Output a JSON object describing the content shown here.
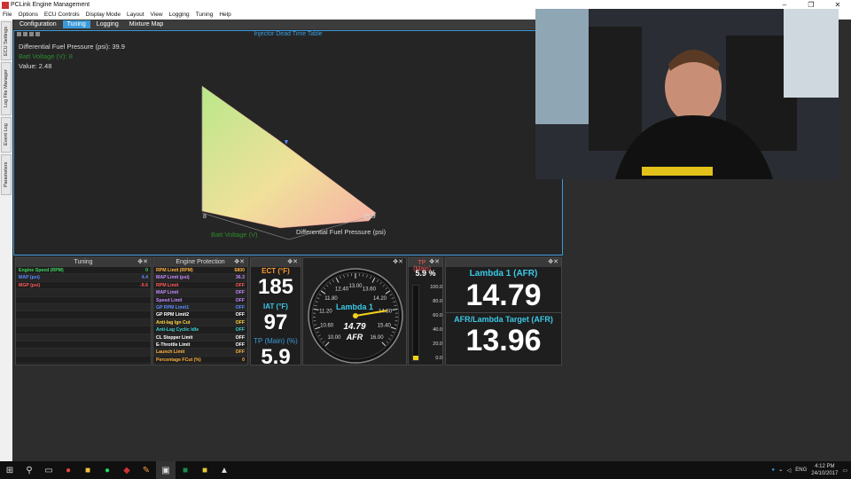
{
  "window": {
    "title": "PCLink Engine Management",
    "controls": [
      "–",
      "❐",
      "✕"
    ]
  },
  "menu": [
    "File",
    "Options",
    "ECU Controls",
    "Display Mode",
    "Layout",
    "View",
    "Logging",
    "Tuning",
    "Help"
  ],
  "side_tabs": [
    "ECU Settings",
    "Log File Manager",
    "Event Log",
    "Parameters"
  ],
  "tabs": [
    {
      "label": "Configuration",
      "active": false
    },
    {
      "label": "Tuning",
      "active": true
    },
    {
      "label": "Logging",
      "active": false
    },
    {
      "label": "Mixture Map",
      "active": false
    }
  ],
  "table3d": {
    "title": "Injector Dead Time Table",
    "info_line1": "Differential Fuel Pressure (psi): 39.9",
    "info_line2": "Batt Voltage (V): 8",
    "info_line3": "Value: 2.48",
    "axis_left_val": "8",
    "axis_right_val": "39.9",
    "axis_label_x": "Differential Fuel Pressure (psi)",
    "axis_label_y": "Batt Voltage (V)",
    "surface_colors": {
      "high": "#b9e88a",
      "low": "#f6b0a6"
    }
  },
  "tuning_panel": {
    "title": "Tuning",
    "rows": [
      {
        "name": "Engine Speed (RPM)",
        "value": "0",
        "color": "#3cd45a"
      },
      {
        "name": "MAP (psi)",
        "value": "4.4",
        "color": "#5a8cff"
      },
      {
        "name": "MGP (psi)",
        "value": "-9.6",
        "color": "#ff5a5a"
      }
    ]
  },
  "engine_protection": {
    "title": "Engine Protection",
    "rows": [
      {
        "name": "RPM Limit (RPM)",
        "value": "6800",
        "color": "#ffb13c",
        "vcolor": "#ffb13c"
      },
      {
        "name": "MAP Limit (psi)",
        "value": "36.3",
        "color": "#c48cff",
        "vcolor": "#c48cff"
      },
      {
        "name": "RPM Limit",
        "value": "OFF",
        "color": "#ff5a5a",
        "vcolor": "#ff5a5a"
      },
      {
        "name": "MAP Limit",
        "value": "OFF",
        "color": "#c48cff",
        "vcolor": "#c48cff"
      },
      {
        "name": "Speed Limit",
        "value": "OFF",
        "color": "#c48cff",
        "vcolor": "#c48cff"
      },
      {
        "name": "GP RPM Limit1",
        "value": "OFF",
        "color": "#5a8cff",
        "vcolor": "#5a8cff"
      },
      {
        "name": "GP RPM Limit2",
        "value": "OFF",
        "color": "#ffffff",
        "vcolor": "#ffffff"
      },
      {
        "name": "Anti-lag Ign Cut",
        "value": "OFF",
        "color": "#ffd23c",
        "vcolor": "#ffd23c"
      },
      {
        "name": "Anti-Lag Cyclic Idle",
        "value": "OFF",
        "color": "#3cd4d4",
        "vcolor": "#3cd4d4"
      },
      {
        "name": "CL Stepper Limit",
        "value": "OFF",
        "color": "#ffffff",
        "vcolor": "#ffffff"
      },
      {
        "name": "E-Throttle Limit",
        "value": "OFF",
        "color": "#ffffff",
        "vcolor": "#ffffff"
      },
      {
        "name": "Launch Limit",
        "value": "OFF",
        "color": "#ffb13c",
        "vcolor": "#ffb13c"
      },
      {
        "name": "Percentage FCut (%)",
        "value": "0",
        "color": "#ffb13c",
        "vcolor": "#ffb13c"
      }
    ]
  },
  "temps": {
    "ect_label": "ECT (°F)",
    "ect_value": "185",
    "iat_label": "IAT (°F)",
    "iat_value": "97",
    "tp_label": "TP (Main) (%)",
    "tp_value": "5.9"
  },
  "lambda_gauge": {
    "title": "Lambda 1",
    "value": "14.79",
    "unit": "AFR",
    "ticks": [
      "10.00",
      "10.60",
      "11.20",
      "11.80",
      "12.40",
      "13.00",
      "13.60",
      "14.20",
      "14.80",
      "15.40",
      "16.00"
    ],
    "min": 10.0,
    "max": 16.0,
    "reading": 14.79
  },
  "tp_bar": {
    "title": "TP (Main)",
    "value": "5.9 %",
    "ticks": [
      "100.0",
      "80.0",
      "60.0",
      "40.0",
      "20.0",
      "0.0"
    ],
    "level": 5.9
  },
  "afr_panel": {
    "lambda_label": "Lambda 1 (AFR)",
    "lambda_value": "14.79",
    "target_label": "AFR/Lambda Target (AFR)",
    "target_value": "13.96"
  },
  "taskbar": {
    "lang": "ENG",
    "time": "4:12 PM",
    "date": "24/10/2017"
  },
  "colors": {
    "accent": "#3a9ad9",
    "label_cyan": "#3cc8e6",
    "label_orange": "#ff9a2e",
    "needle": "#f2d21a"
  }
}
